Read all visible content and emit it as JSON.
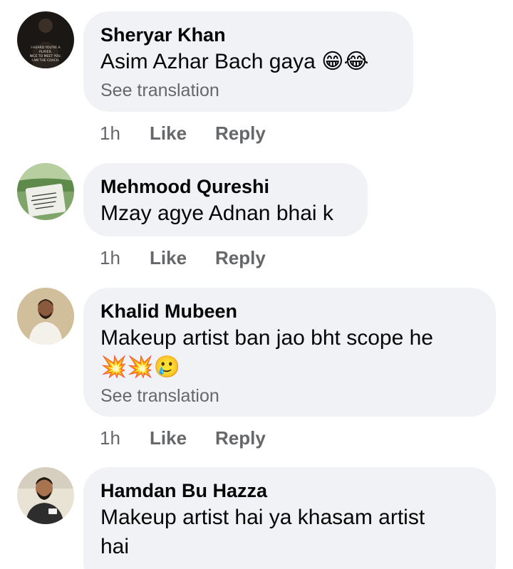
{
  "comments": [
    {
      "author": "Sheryar Khan",
      "text": "Asim Azhar Bach gaya",
      "emoji": "😁😂",
      "see_translation": "See translation",
      "time": "1h",
      "like": "Like",
      "reply": "Reply",
      "avatar_text": "I HEARD YOU'RE A PLAYER. NICE TO MEET YOU. I AM THE COACH."
    },
    {
      "author": "Mehmood Qureshi",
      "text": "Mzay agye Adnan bhai k",
      "time": "1h",
      "like": "Like",
      "reply": "Reply"
    },
    {
      "author": "Khalid Mubeen",
      "text": "Makeup artist ban jao bht scope he",
      "emoji": "💥💥🥲",
      "see_translation": "See translation",
      "time": "1h",
      "like": "Like",
      "reply": "Reply"
    },
    {
      "author": "Hamdan Bu Hazza",
      "text_line1": "Makeup artist hai ya khasam artist",
      "text_line2": "hai"
    }
  ]
}
